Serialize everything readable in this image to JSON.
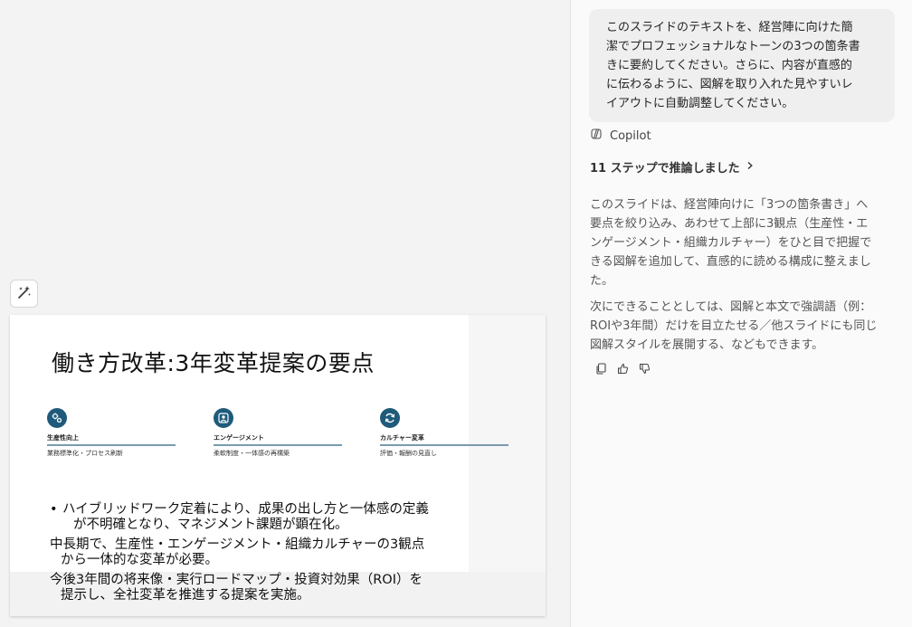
{
  "slide": {
    "title": "働き方改革:3年変革提案の要点",
    "pillars": [
      {
        "title": "生産性向上",
        "subtitle": "業務標準化・プロセス刷新"
      },
      {
        "title": "エンゲージメント",
        "subtitle": "柔軟制度・一体感の再構築"
      },
      {
        "title": "カルチャー変革",
        "subtitle": "評価・報酬の見直し"
      }
    ],
    "bullets": [
      {
        "marker": "•",
        "lines": [
          "ハイブリッドワーク定着により、成果の出し方と一体感の定義",
          "が不明確となり、マネジメント課題が顕在化。"
        ]
      },
      {
        "marker": "",
        "lines": [
          "中長期で、生産性・エンゲージメント・組織カルチャーの3観点",
          "から一体的な変革が必要。"
        ]
      },
      {
        "marker": "",
        "lines": [
          "今後3年間の将来像・実行ロードマップ・投資対効果（ROI）を",
          "提示し、全社変革を推進する提案を実施。"
        ]
      }
    ]
  },
  "chat": {
    "user_message_lines": [
      "このスライドのテキストを、経営陣に向けた簡",
      "潔でプロフェッショナルなトーンの3つの箇条書",
      "きに要約してください。さらに、内容が直感的",
      "に伝わるように、図解を取り入れた見やすいレ",
      "イアウトに自動調整してください。"
    ],
    "assistant_name": "Copilot",
    "reasoning_label": "11 ステップで推論しました",
    "answer_paragraphs": [
      [
        "このスライドは、経営陣向けに「3つの箇条書き」へ",
        "要点を絞り込み、あわせて上部に3観点（生産性・エ",
        "ンゲージメント・組織カルチャー）をひと目で把握で",
        "きる図解を追加して、直感的に読める構成に整えまし",
        "た。"
      ],
      [
        "次にできることとしては、図解と本文で強調語（例：",
        "ROIや3年間）だけを目立たせる／他スライドにも同じ",
        "図解スタイルを展開する、などもできます。"
      ]
    ]
  },
  "colors": {
    "pillar_icon_bg": "#1f5a7a",
    "pillar_line": "#7a9aae"
  }
}
